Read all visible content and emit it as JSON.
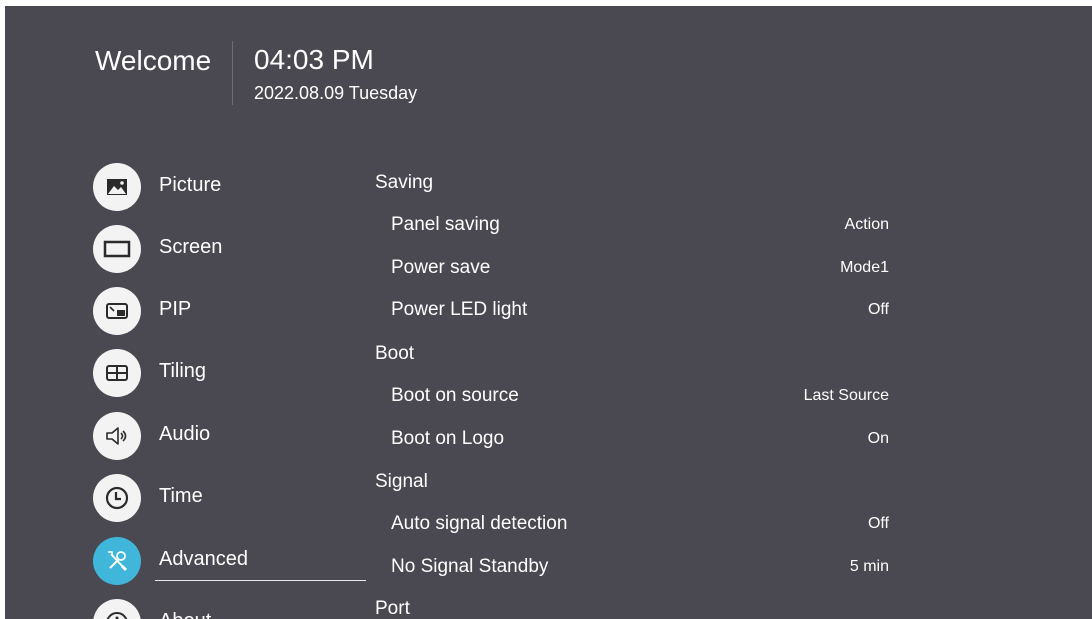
{
  "header": {
    "welcome": "Welcome",
    "time": "04:03 PM",
    "date": "2022.08.09 Tuesday"
  },
  "sidebar": {
    "active": "Advanced",
    "items": [
      {
        "label": "Picture",
        "icon": "picture-icon"
      },
      {
        "label": "Screen",
        "icon": "screen-icon"
      },
      {
        "label": "PIP",
        "icon": "pip-icon"
      },
      {
        "label": "Tiling",
        "icon": "tiling-icon"
      },
      {
        "label": "Audio",
        "icon": "audio-icon"
      },
      {
        "label": "Time",
        "icon": "clock-icon"
      },
      {
        "label": "Advanced",
        "icon": "tools-icon"
      },
      {
        "label": "About",
        "icon": "info-icon"
      }
    ]
  },
  "settings": {
    "saving": {
      "title": "Saving",
      "items": [
        {
          "label": "Panel saving",
          "value": "Action"
        },
        {
          "label": "Power save",
          "value": "Mode1"
        },
        {
          "label": "Power LED light",
          "value": "Off"
        }
      ]
    },
    "boot": {
      "title": "Boot",
      "items": [
        {
          "label": "Boot on source",
          "value": "Last Source"
        },
        {
          "label": "Boot on Logo",
          "value": "On"
        }
      ]
    },
    "signal": {
      "title": "Signal",
      "items": [
        {
          "label": "Auto signal detection",
          "value": "Off"
        },
        {
          "label": "No Signal Standby",
          "value": "5 min"
        }
      ]
    },
    "port": {
      "title": "Port"
    }
  },
  "colors": {
    "background": "#4a4850",
    "accent": "#3fb6da",
    "icon_circle": "#f3f3f3"
  }
}
